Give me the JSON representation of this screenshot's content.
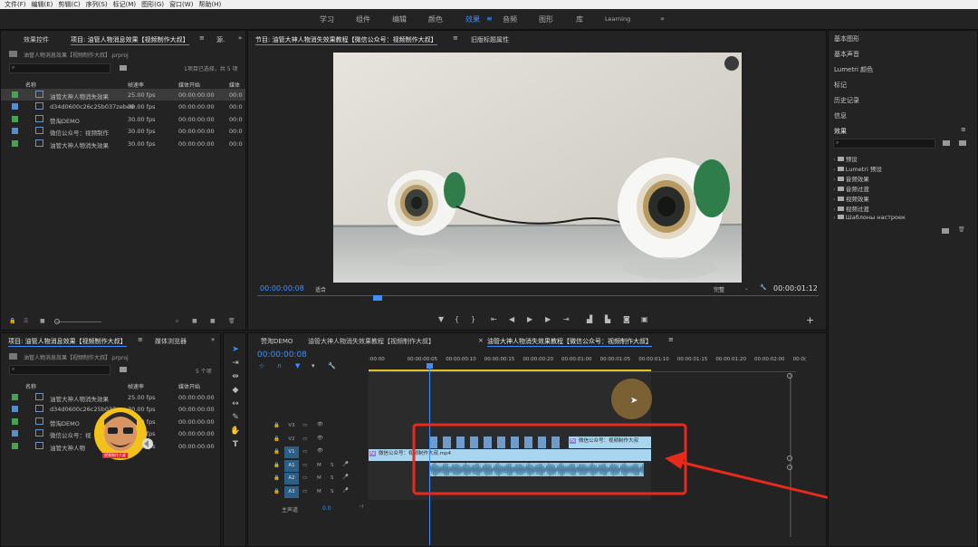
{
  "menu": [
    "文件(F)",
    "编辑(E)",
    "剪辑(C)",
    "序列(S)",
    "标记(M)",
    "图形(G)",
    "窗口(W)",
    "帮助(H)"
  ],
  "workspaces": {
    "items": [
      "学习",
      "组件",
      "编辑",
      "颜色",
      "效果",
      "音频",
      "图形",
      "库",
      "Learning"
    ],
    "active_index": 4,
    "more": "»"
  },
  "project_top": {
    "tabs": [
      "效果控件",
      "项目: 油管人物消息效果【视频制作大叔】",
      "源."
    ],
    "more": "»",
    "file": "油管人物消息效果【视频制作大叔】.prproj",
    "selection": "1项目已选择，共 5 项",
    "headers": [
      "名称",
      "帧速率",
      "媒体开始",
      "媒体"
    ],
    "rows": [
      {
        "name": "油管大神人物消失效果",
        "fps": "25.00 fps",
        "start": "00:00:00:00",
        "media": "00:0",
        "color": "#3fa84b",
        "icon": "sequence-icon"
      },
      {
        "name": "d34d0600c26c25b037zebe9",
        "fps": "30.00 fps",
        "start": "00:00:00:00",
        "media": "00:0",
        "color": "#4f8fd8",
        "icon": "clip-icon"
      },
      {
        "name": "赞淘DEMO",
        "fps": "30.00 fps",
        "start": "00:00:00:00",
        "media": "00:0",
        "color": "#3fa84b",
        "icon": "sequence-icon"
      },
      {
        "name": "微信公众号：视频制作",
        "fps": "30.00 fps",
        "start": "00:00:00:00",
        "media": "00:0",
        "color": "#4f8fd8",
        "icon": "clip-icon"
      },
      {
        "name": "油管大神人物消失效果",
        "fps": "30.00 fps",
        "start": "00:00:00:00",
        "media": "00:0",
        "color": "#3fa84b",
        "icon": "sequence-icon"
      }
    ]
  },
  "project_bottom": {
    "tabs": [
      "项目: 油管人物消息效果【视频制作大叔】",
      "媒体浏览器"
    ],
    "more": "»",
    "file": "油管人物消息效果【视频制作大叔】.prproj",
    "count": "5 个项",
    "headers": [
      "名称",
      "帧速率",
      "媒体开始",
      "媒体"
    ],
    "rows": [
      {
        "name": "油管大神人物消失效果",
        "fps": "25.00 fps",
        "start": "00:00:00:00",
        "media": "00:0",
        "color": "#3fa84b"
      },
      {
        "name": "d34d0600c26c25b037",
        "fps": "30.00 fps",
        "start": "00:00:00:00",
        "media": "00:0",
        "color": "#4f8fd8"
      },
      {
        "name": "赞淘DEMO",
        "fps": "30.00 fps",
        "start": "00:00:00:00",
        "media": "00:0",
        "color": "#3fa84b"
      },
      {
        "name": "微信公众号：视",
        "fps": "30.00 fps",
        "start": "00:00:00:00",
        "media": "00:0",
        "color": "#4f8fd8"
      },
      {
        "name": "油管大神人物",
        "fps": "30.00 fps",
        "start": "00:00:00:00",
        "media": "00:0",
        "color": "#3fa84b"
      }
    ]
  },
  "program": {
    "title": "节目: 油管大神人物消失效果教程【微信公众号：视频制作大叔】",
    "title_menu": "≡",
    "tab2": "旧版标题属性",
    "timecode": "00:00:00:08",
    "fit": "适合",
    "quality": "完整",
    "duration": "00:00:01:12"
  },
  "timeline": {
    "tabs": [
      "赞淘DEMO",
      "油管大神人物消失效果教程【视频制作大叔】",
      "油管大神人物消失效果教程【微信公众号：视频制作大叔】"
    ],
    "close": "×",
    "timecode": "00:00:00:08",
    "ruler": [
      ":00:00",
      "00:00:00:05",
      "00:00:00:10",
      "00:00:00:15",
      "00:00:00:20",
      "00:00:01:00",
      "00:00:01:05",
      "00:00:01:10",
      "00:00:01:15",
      "00:00:01:20",
      "00:00:02:00",
      "00:0("
    ],
    "video_tracks": [
      "V3",
      "V2",
      "V1"
    ],
    "audio_tracks": [
      "A1",
      "A2",
      "A3"
    ],
    "master": "主声道",
    "master_value": "0.0",
    "clip_v2": "微信公众号：视频制作大叔",
    "clip_v1": "微信公众号：视频制作大叔.mp4",
    "fx": "fx"
  },
  "right_panel": {
    "items": [
      "基本图形",
      "基本声音",
      "Lumetri 颜色",
      "标记",
      "历史记录",
      "信息"
    ],
    "effects_title": "效果",
    "effects": [
      "预设",
      "Lumetri 预设",
      "音频效果",
      "音频过渡",
      "视频效果",
      "视频过渡",
      "Шаблоны настроек"
    ]
  },
  "avatar_text": "视频制作大叔",
  "colors": {
    "accent": "#3d8fff",
    "highlight": "#e8291c",
    "clip_video": "#a9d6ee",
    "clip_audio": "#8fc6e3",
    "cursor": "#8a6a35"
  }
}
